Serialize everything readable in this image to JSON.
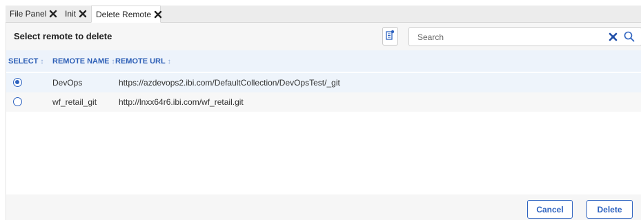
{
  "tabs": [
    {
      "label": "File Panel"
    },
    {
      "label": "Init"
    },
    {
      "label": "Delete Remote",
      "active": true
    }
  ],
  "header": {
    "title": "Select remote to delete",
    "search_placeholder": "Search",
    "search_value": ""
  },
  "table": {
    "columns": [
      "SELECT",
      "REMOTE NAME",
      "REMOTE URL"
    ],
    "rows": [
      {
        "name": "DevOps",
        "url": "https://azdevops2.ibi.com/DefaultCollection/DevOpsTest/_git",
        "selected": true
      },
      {
        "name": "wf_retail_git",
        "url": "http://lnxx64r6.ibi.com/wf_retail.git",
        "selected": false
      }
    ]
  },
  "footer": {
    "cancel_label": "Cancel",
    "delete_label": "Delete"
  },
  "colors": {
    "accent": "#2e63c0",
    "header_bg": "#f6f6f6",
    "table_header_bg": "#edf3fb",
    "selected_row_bg": "#eef4fb"
  },
  "icons": [
    "close-icon",
    "filter-settings-icon",
    "clear-search-icon",
    "search-icon",
    "sort-icon",
    "radio-checked-icon",
    "radio-unchecked-icon"
  ]
}
